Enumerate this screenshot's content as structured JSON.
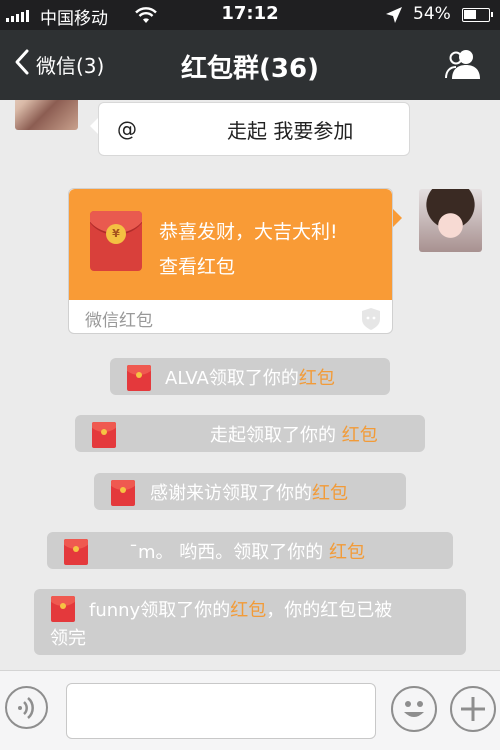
{
  "status_bar": {
    "carrier": "中国移动",
    "time": "17:12",
    "battery_percent_label": "54%",
    "battery_level": 0.54
  },
  "nav": {
    "back_label": "微信(3)",
    "title": "红包群(36)"
  },
  "messages": {
    "partial_text": {
      "mention": "@",
      "body": "走起 我要参加"
    },
    "red_packet": {
      "greeting": "恭喜发财，大吉大利!",
      "action": "查看红包",
      "footer": "微信红包",
      "coin_symbol": "¥"
    }
  },
  "notices": [
    {
      "prefix": "ALVA领取了你的",
      "highlight": "红包"
    },
    {
      "prefix": "走起领取了你的 ",
      "highlight": "红包"
    },
    {
      "prefix": "感谢来访领取了你的",
      "highlight": "红包"
    },
    {
      "prefix": "¯m。      哟西。领取了你的 ",
      "highlight": "红包"
    },
    {
      "prefix": "funny领取了你的",
      "highlight": "红包",
      "suffix": "，你的红包已被",
      "line2": "领完"
    }
  ],
  "colors": {
    "nav_bg": "#2e3133",
    "red_packet_orange": "#f99b36",
    "highlight_orange": "#f29b38",
    "notice_bg": "#cecece",
    "envelope_red": "#d9403b"
  },
  "icons": [
    "signal-icon",
    "wifi-icon",
    "location-arrow-icon",
    "battery-icon",
    "back-chevron-icon",
    "group-members-icon",
    "red-envelope-icon",
    "shield-icon",
    "voice-icon",
    "emoji-icon",
    "plus-icon"
  ]
}
